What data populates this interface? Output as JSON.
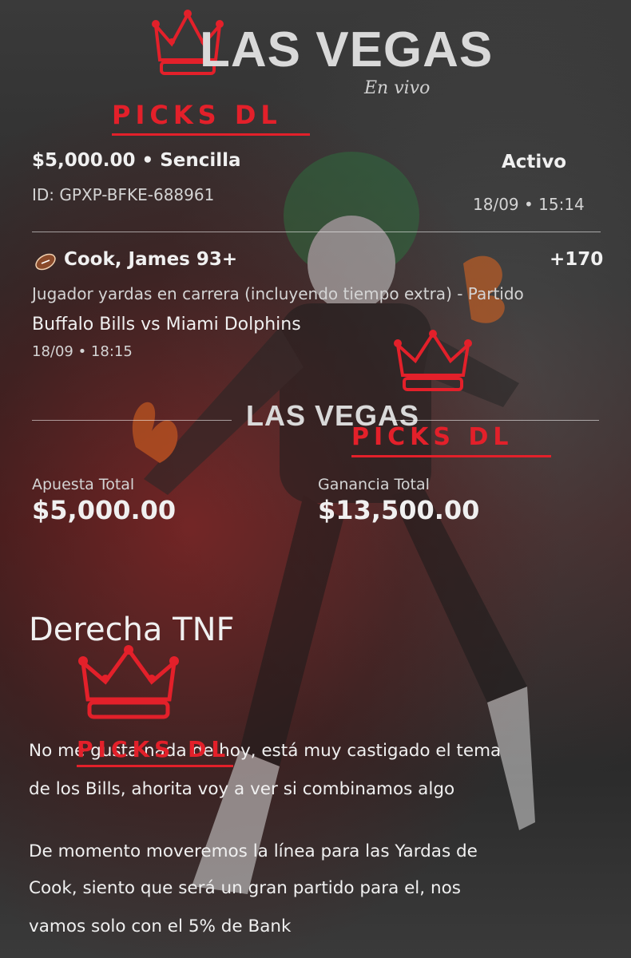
{
  "watermark": {
    "brand": "LAS VEGAS",
    "sub": "En vivo",
    "picks": "PICKS DL"
  },
  "bet": {
    "amount_type": "$5,000.00 • Sencilla",
    "status": "Activo",
    "id": "ID: GPXP-BFKE-688961",
    "placed_at": "18/09 • 15:14"
  },
  "selection": {
    "sport_icon": "football-icon",
    "player": "Cook, James 93+",
    "odds": "+170",
    "market": "Jugador yardas en carrera (incluyendo tiempo extra) - Partido",
    "match": "Buffalo Bills vs Miami Dolphins",
    "match_time": "18/09 • 18:15"
  },
  "totals": {
    "stake_label": "Apuesta Total",
    "stake_value": "$5,000.00",
    "payout_label": "Ganancia Total",
    "payout_value": "$13,500.00"
  },
  "post": {
    "title": "Derecha TNF",
    "paragraph1_line1": "No me gusta nada de hoy, está muy castigado el tema",
    "paragraph1_line2": "de los Bills, ahorita voy a ver si combinamos algo",
    "paragraph2_line1": "De momento moveremos la línea para las Yardas de",
    "paragraph2_line2": "Cook, siento que será un gran partido para el, nos",
    "paragraph2_line3": "vamos solo con el 5% de Bank"
  },
  "colors": {
    "accent_red": "#e3202a",
    "text": "#e6e6e6"
  }
}
